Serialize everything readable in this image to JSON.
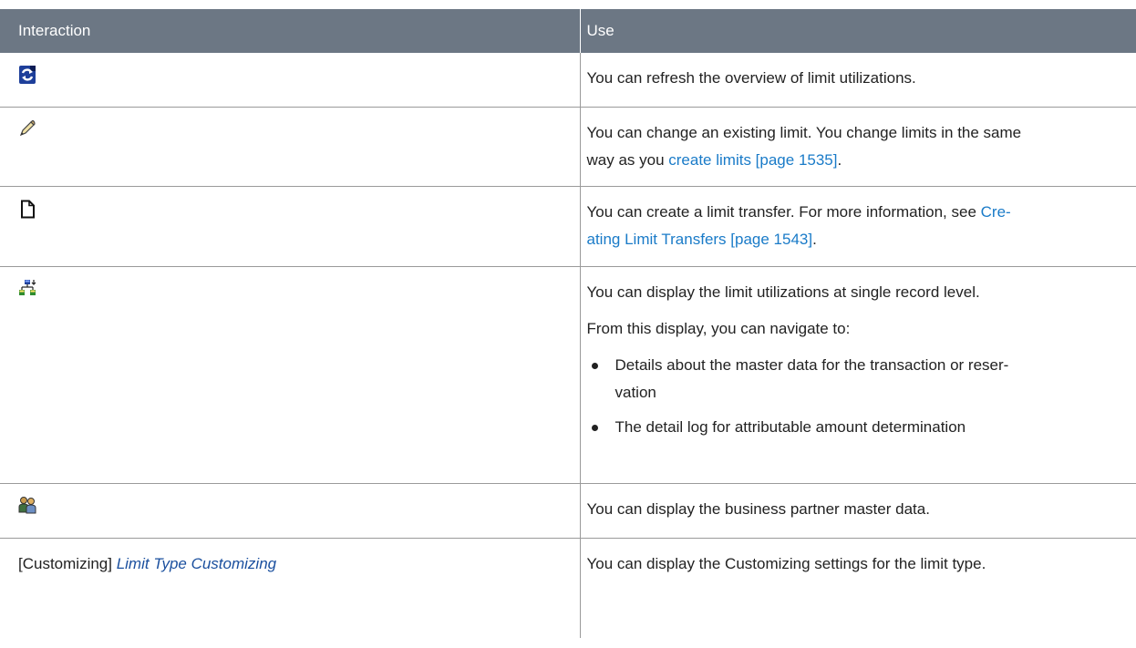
{
  "table": {
    "headers": {
      "interaction": "Interaction",
      "use": "Use"
    },
    "rows": [
      {
        "icon": "refresh-icon",
        "use": "You can refresh the overview of limit utilizations."
      },
      {
        "icon": "pencil-icon",
        "use_line1": "You can change an existing limit. You change limits in the same",
        "use_line2_prefix": "way as you ",
        "use_line2_link": "create limits [page 1535]",
        "use_line2_suffix": "."
      },
      {
        "icon": "new-document-icon",
        "use_line1_prefix": "You can create a limit transfer. For more information, see ",
        "use_line1_link": "Cre-",
        "use_line2_link": "ating Limit Transfers [page 1543]",
        "use_line2_suffix": "."
      },
      {
        "icon": "hierarchy-drilldown-icon",
        "use_para1": "You can display the limit utilizations at single record level.",
        "use_para2": "From this display, you can navigate to:",
        "bullet1_line1": "Details about the master data for the transaction or reser-",
        "bullet1_line2": "vation",
        "bullet2": "The detail log for attributable amount determination"
      },
      {
        "icon": "business-partner-icon",
        "use": "You can display the business partner master data."
      },
      {
        "interaction_prefix": "[Customizing] ",
        "interaction_link": "Limit Type Customizing",
        "use": "You can display the Customizing settings for the limit type."
      }
    ]
  },
  "colors": {
    "header_bg": "#6c7784",
    "link": "#1a7bc8",
    "italic_link": "#1a4f9e",
    "border": "#9a9a9a"
  }
}
